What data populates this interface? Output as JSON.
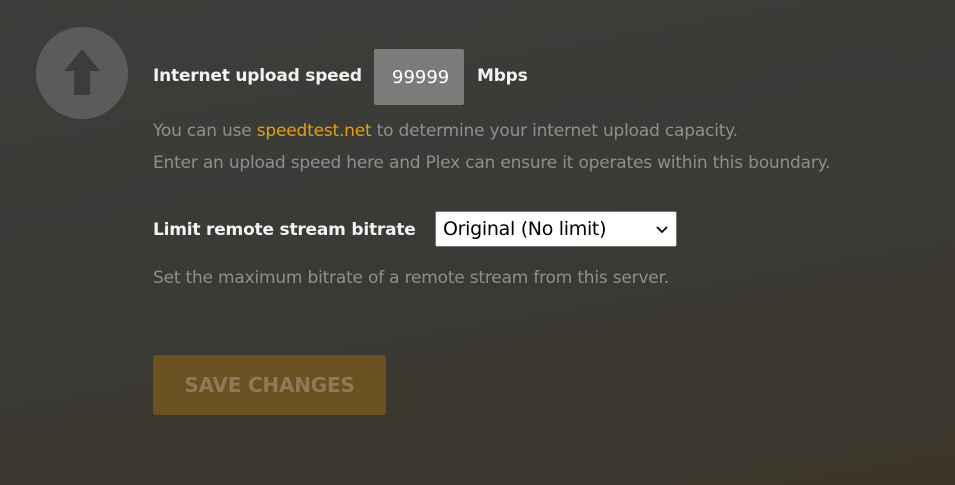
{
  "upload": {
    "icon": "arrow-up-icon",
    "label": "Internet upload speed",
    "value": "99999",
    "unit": "Mbps",
    "help_prefix": "You can use ",
    "help_link": "speedtest.net",
    "help_suffix": " to determine your internet upload capacity.",
    "help_line2": "Enter an upload speed here and Plex can ensure it operates within this boundary."
  },
  "bitrate": {
    "label": "Limit remote stream bitrate",
    "selected": "Original (No limit)",
    "help": "Set the maximum bitrate of a remote stream from this server."
  },
  "actions": {
    "save_label": "SAVE CHANGES"
  },
  "colors": {
    "accent": "#e5a00d",
    "save_button_bg": "#6b5022",
    "help_text": "#8f8f8d"
  }
}
